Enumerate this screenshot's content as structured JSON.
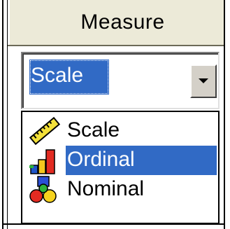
{
  "column": {
    "header": "Measure"
  },
  "combo": {
    "value": "Scale",
    "button_icon": "chevron-down-icon"
  },
  "dropdown": {
    "items": [
      {
        "label": "Scale",
        "icon": "ruler-icon",
        "selected": false
      },
      {
        "label": "Ordinal",
        "icon": "bar-chart-icon",
        "selected": true
      },
      {
        "label": "Nominal",
        "icon": "shapes-icon",
        "selected": false
      }
    ]
  },
  "colors": {
    "selection": "#316ac5",
    "header_bg": "#ecead8",
    "button_bg": "#d4d0c8"
  }
}
